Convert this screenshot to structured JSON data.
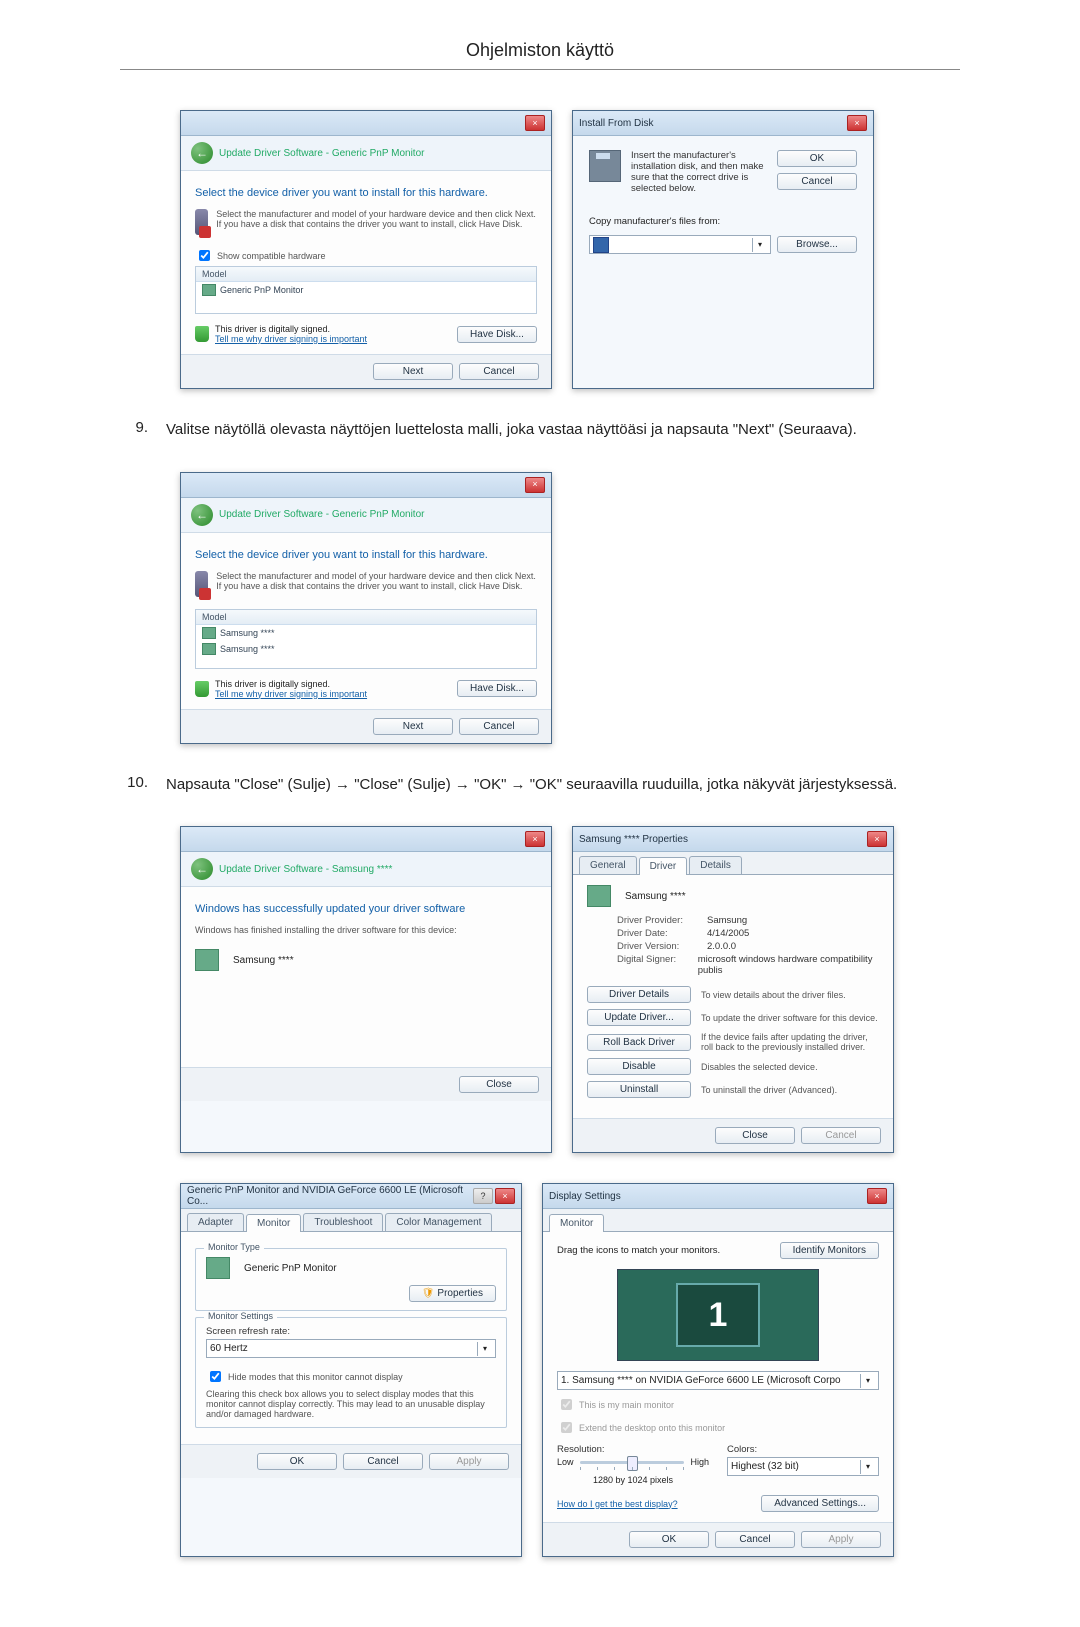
{
  "page_header": "Ohjelmiston käyttö",
  "steps": {
    "s9": {
      "num": "9.",
      "text": "Valitse näytöllä olevasta näyttöjen luettelosta malli, joka vastaa näyttöäsi ja napsauta \"Next\" (Seuraava)."
    },
    "s10": {
      "num": "10.",
      "text": "Napsauta \"Close\" (Sulje) → \"Close\" (Sulje) → \"OK\" → \"OK\" seuraavilla ruuduilla, jotka näkyvät järjestyksessä."
    }
  },
  "win_update1": {
    "crumb": "Update Driver Software - Generic PnP Monitor",
    "title": "Select the device driver you want to install for this hardware.",
    "hint": "Select the manufacturer and model of your hardware device and then click Next. If you have a disk that contains the driver you want to install, click Have Disk.",
    "compat": "Show compatible hardware",
    "hdr": "Model",
    "row": "Generic PnP Monitor",
    "signed": "This driver is digitally signed.",
    "tell": "Tell me why driver signing is important",
    "have_disk": "Have Disk...",
    "next": "Next",
    "cancel": "Cancel"
  },
  "win_ifd": {
    "title": "Install From Disk",
    "msg": "Insert the manufacturer's installation disk, and then make sure that the correct drive is selected below.",
    "ok": "OK",
    "cancel": "Cancel",
    "copy": "Copy manufacturer's files from:",
    "browse": "Browse..."
  },
  "win_update2": {
    "crumb": "Update Driver Software - Generic PnP Monitor",
    "title": "Select the device driver you want to install for this hardware.",
    "hint": "Select the manufacturer and model of your hardware device and then click Next. If you have a disk that contains the driver you want to install, click Have Disk.",
    "hdr": "Model",
    "row1": "Samsung ****",
    "row2": "Samsung ****",
    "signed": "This driver is digitally signed.",
    "tell": "Tell me why driver signing is important",
    "have_disk": "Have Disk...",
    "next": "Next",
    "cancel": "Cancel"
  },
  "win_success": {
    "crumb": "Update Driver Software - Samsung ****",
    "title": "Windows has successfully updated your driver software",
    "sub": "Windows has finished installing the driver software for this device:",
    "dev": "Samsung ****",
    "close": "Close"
  },
  "win_props_driver": {
    "title": "Samsung **** Properties",
    "tabs": {
      "general": "General",
      "driver": "Driver",
      "details": "Details"
    },
    "dev": "Samsung ****",
    "kv": {
      "provider_k": "Driver Provider:",
      "provider_v": "Samsung",
      "date_k": "Driver Date:",
      "date_v": "4/14/2005",
      "version_k": "Driver Version:",
      "version_v": "2.0.0.0",
      "signer_k": "Digital Signer:",
      "signer_v": "microsoft windows hardware compatibility publis"
    },
    "btns": {
      "details": "Driver Details",
      "details_d": "To view details about the driver files.",
      "update": "Update Driver...",
      "update_d": "To update the driver software for this device.",
      "rollback": "Roll Back Driver",
      "rollback_d": "If the device fails after updating the driver, roll back to the previously installed driver.",
      "disable": "Disable",
      "disable_d": "Disables the selected device.",
      "uninstall": "Uninstall",
      "uninstall_d": "To uninstall the driver (Advanced)."
    },
    "close": "Close",
    "cancel": "Cancel"
  },
  "win_monitor_props": {
    "title": "Generic PnP Monitor and NVIDIA GeForce 6600 LE (Microsoft Co...",
    "tabs": {
      "adapter": "Adapter",
      "monitor": "Monitor",
      "troubleshoot": "Troubleshoot",
      "color": "Color Management"
    },
    "type_grp": "Monitor Type",
    "type_val": "Generic PnP Monitor",
    "properties": "Properties",
    "settings_grp": "Monitor Settings",
    "refresh_lbl": "Screen refresh rate:",
    "refresh_val": "60 Hertz",
    "hide": "Hide modes that this monitor cannot display",
    "hide_desc": "Clearing this check box allows you to select display modes that this monitor cannot display correctly. This may lead to an unusable display and/or damaged hardware.",
    "ok": "OK",
    "cancel": "Cancel",
    "apply": "Apply"
  },
  "win_display": {
    "title": "Display Settings",
    "tab": "Monitor",
    "drag": "Drag the icons to match your monitors.",
    "identify": "Identify Monitors",
    "num": "1",
    "sel": "1. Samsung **** on NVIDIA GeForce 6600 LE (Microsoft Corpo",
    "main_chk": "This is my main monitor",
    "extend_chk": "Extend the desktop onto this monitor",
    "res_lbl": "Resolution:",
    "low": "Low",
    "high": "High",
    "res_val": "1280 by 1024 pixels",
    "colors_lbl": "Colors:",
    "colors_val": "Highest (32 bit)",
    "best": "How do I get the best display?",
    "adv": "Advanced Settings...",
    "ok": "OK",
    "cancel": "Cancel",
    "apply": "Apply"
  }
}
